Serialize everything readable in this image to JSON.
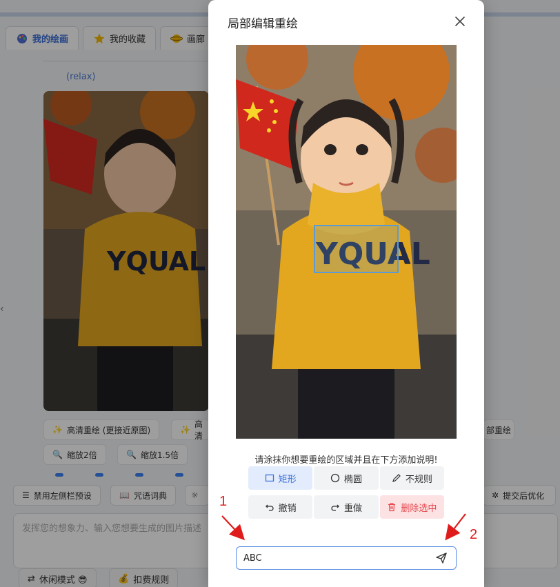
{
  "background": {
    "tabs": [
      {
        "label": "我的绘画",
        "active": true
      },
      {
        "label": "我的收藏",
        "active": false
      },
      {
        "label": "画廊",
        "active": false
      }
    ],
    "relax_label": "(relax)",
    "image_buttons": {
      "hd_redraw": "高清重绘 (更接近原图)",
      "hd_partial": "高清",
      "partial_right": "部重绘",
      "zoom_2x": "缩放2倍",
      "zoom_15x": "缩放1.5倍"
    },
    "toolbar": {
      "disable_sidebar": "禁用左侧栏预设",
      "spell_dict": "咒语词典",
      "optimize_after_submit": "提交后优化"
    },
    "prompt_placeholder": "发挥您的想象力、输入您想要生成的图片描述",
    "bottom": {
      "idle_mode": "休闲模式 😎",
      "billing_rules": "扣费规则"
    }
  },
  "modal": {
    "title": "局部编辑重绘",
    "instruction": "请涂抹你想要重绘的区域并且在下方添加说明!",
    "shapes": [
      {
        "label": "矩形",
        "icon": "square-icon",
        "active": true
      },
      {
        "label": "椭圆",
        "icon": "circle-icon",
        "active": false
      },
      {
        "label": "不规则",
        "icon": "pencil-icon",
        "active": false
      }
    ],
    "actions": {
      "undo": "撤销",
      "redo": "重做",
      "delete_selected": "删除选中"
    },
    "input_value": "ABC",
    "shirt_text": "YQUAL"
  },
  "annotations": {
    "label_1": "1",
    "label_2": "2",
    "color": "#e01b1b"
  }
}
